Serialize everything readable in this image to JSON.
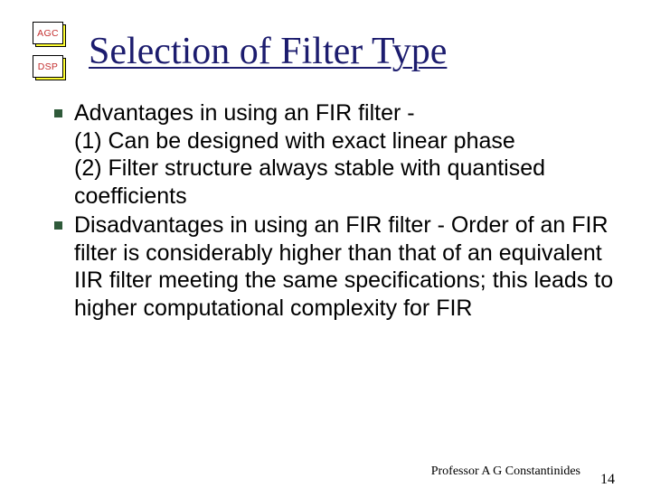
{
  "logo": {
    "top": "AGC",
    "bottom": "DSP"
  },
  "title": "Selection of Filter Type",
  "bullets": [
    {
      "lead": "Advantages in using an FIR filter -",
      "lines": [
        "(1) Can be designed with exact linear phase",
        "(2)  Filter structure always stable with quantised coefficients"
      ]
    },
    {
      "lead": "Disadvantages in using an FIR filter - Order of an FIR filter  is considerably higher than that of an equivalent IIR filter meeting the same specifications; this leads to higher computational complexity for FIR",
      "lines": []
    }
  ],
  "footer": {
    "professor": "Professor A G Constantinides",
    "page": "14"
  }
}
